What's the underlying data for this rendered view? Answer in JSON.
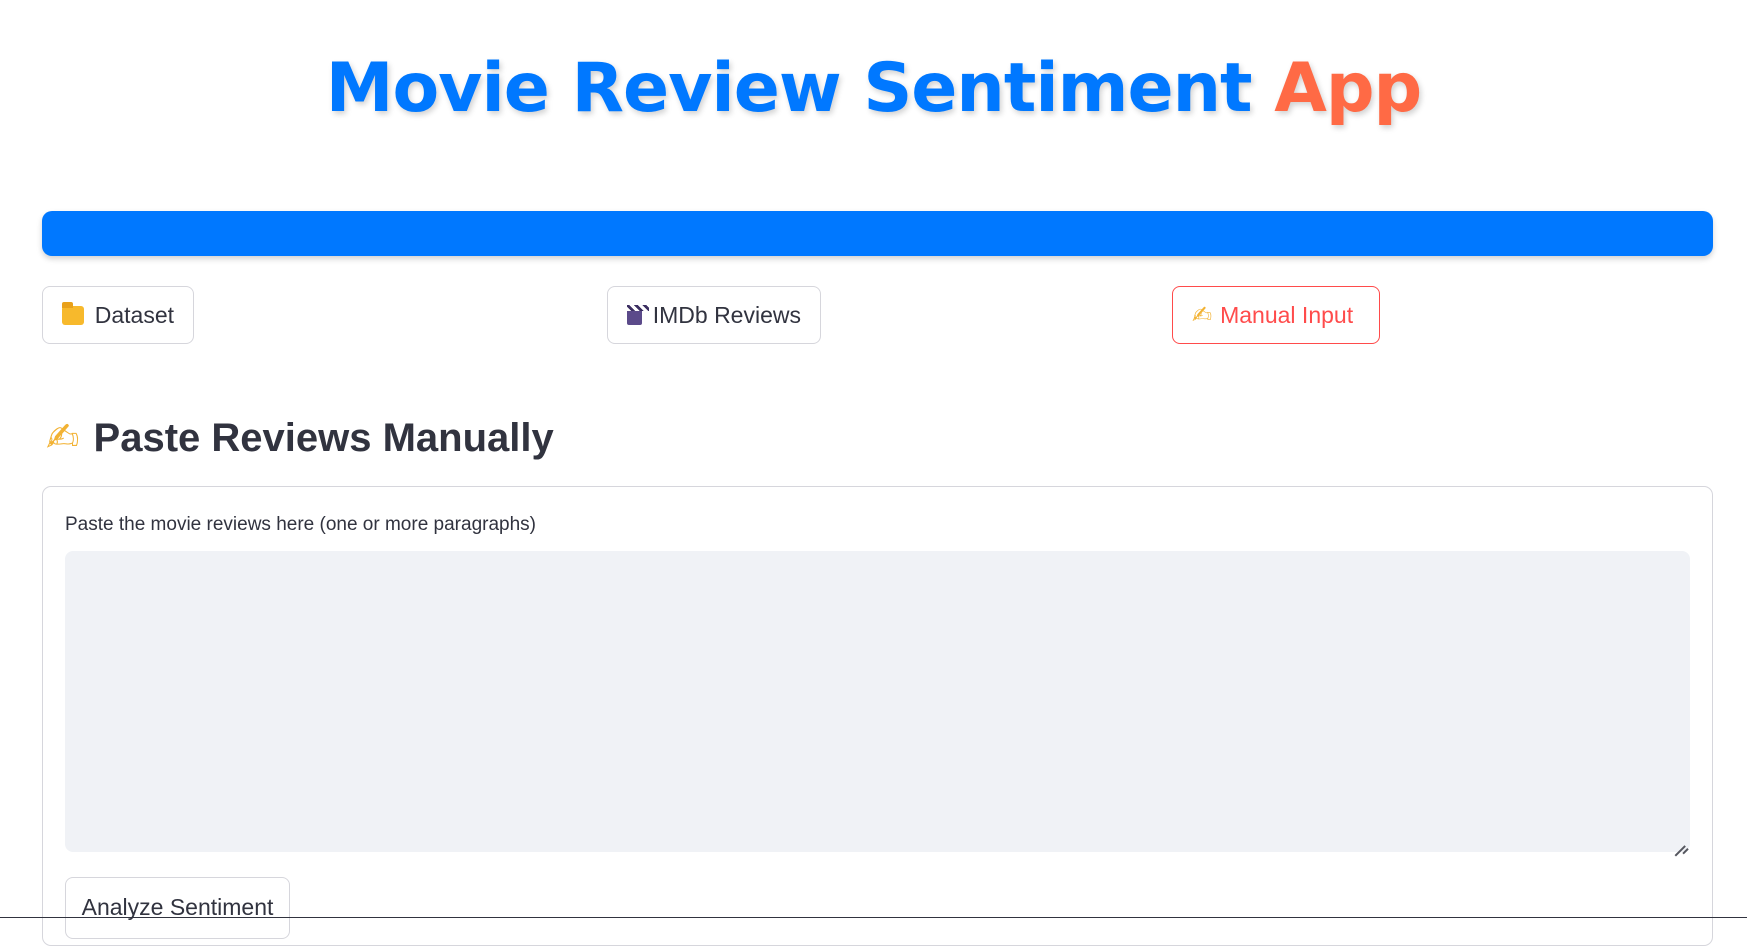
{
  "header": {
    "title_main": "Movie Review Sentiment",
    "title_accent": "App",
    "accent_color": "#ff6a45",
    "primary_color": "#0078ff"
  },
  "tabs": [
    {
      "label": "Dataset",
      "icon": "folder-icon",
      "active": false
    },
    {
      "label": "IMDb Reviews",
      "icon": "clapper-board-icon",
      "active": false
    },
    {
      "label": "Manual Input",
      "icon": "writing-hand-icon",
      "active": true
    }
  ],
  "section": {
    "heading": "Paste Reviews Manually",
    "heading_icon": "writing-hand-icon"
  },
  "form": {
    "textarea_label": "Paste the movie reviews here (one or more paragraphs)",
    "textarea_value": "",
    "analyze_button_label": "Analyze Sentiment"
  },
  "colors": {
    "active_tab": "#ff4b4b",
    "textarea_bg": "#f0f2f6",
    "text": "#31333f"
  }
}
